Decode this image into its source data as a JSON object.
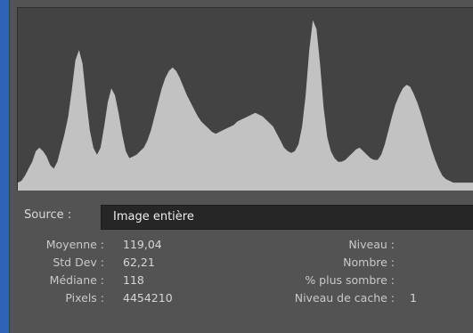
{
  "histogram": {
    "profile": [
      0.02,
      0.03,
      0.06,
      0.1,
      0.14,
      0.2,
      0.22,
      0.2,
      0.17,
      0.12,
      0.1,
      0.14,
      0.22,
      0.3,
      0.4,
      0.55,
      0.72,
      0.78,
      0.7,
      0.5,
      0.32,
      0.22,
      0.18,
      0.22,
      0.34,
      0.48,
      0.56,
      0.52,
      0.42,
      0.3,
      0.2,
      0.16,
      0.17,
      0.18,
      0.2,
      0.22,
      0.26,
      0.32,
      0.4,
      0.48,
      0.56,
      0.62,
      0.66,
      0.68,
      0.66,
      0.62,
      0.57,
      0.52,
      0.48,
      0.44,
      0.4,
      0.37,
      0.35,
      0.33,
      0.31,
      0.3,
      0.31,
      0.32,
      0.33,
      0.34,
      0.35,
      0.37,
      0.38,
      0.39,
      0.4,
      0.41,
      0.42,
      0.41,
      0.4,
      0.38,
      0.36,
      0.34,
      0.3,
      0.26,
      0.22,
      0.2,
      0.19,
      0.2,
      0.24,
      0.34,
      0.52,
      0.78,
      0.95,
      0.9,
      0.7,
      0.45,
      0.28,
      0.2,
      0.16,
      0.14,
      0.14,
      0.15,
      0.17,
      0.19,
      0.21,
      0.22,
      0.2,
      0.18,
      0.16,
      0.15,
      0.15,
      0.18,
      0.24,
      0.32,
      0.4,
      0.47,
      0.52,
      0.56,
      0.58,
      0.57,
      0.53,
      0.48,
      0.42,
      0.35,
      0.28,
      0.21,
      0.15,
      0.1,
      0.06,
      0.04,
      0.03,
      0.02,
      0.02,
      0.02,
      0.02,
      0.02,
      0.02,
      0.02
    ],
    "fill_color": "#c2c2c2",
    "background_color": "#434343"
  },
  "source": {
    "label": "Source :",
    "value": "Image entière"
  },
  "stats_left": [
    {
      "label": "Moyenne :",
      "value": "119,04"
    },
    {
      "label": "Std Dev :",
      "value": "62,21"
    },
    {
      "label": "Médiane :",
      "value": "118"
    },
    {
      "label": "Pixels :",
      "value": "4454210"
    }
  ],
  "stats_right": [
    {
      "label": "Niveau :",
      "value": ""
    },
    {
      "label": "Nombre :",
      "value": ""
    },
    {
      "label": "% plus sombre :",
      "value": ""
    },
    {
      "label": "Niveau de cache :",
      "value": "1"
    }
  ]
}
